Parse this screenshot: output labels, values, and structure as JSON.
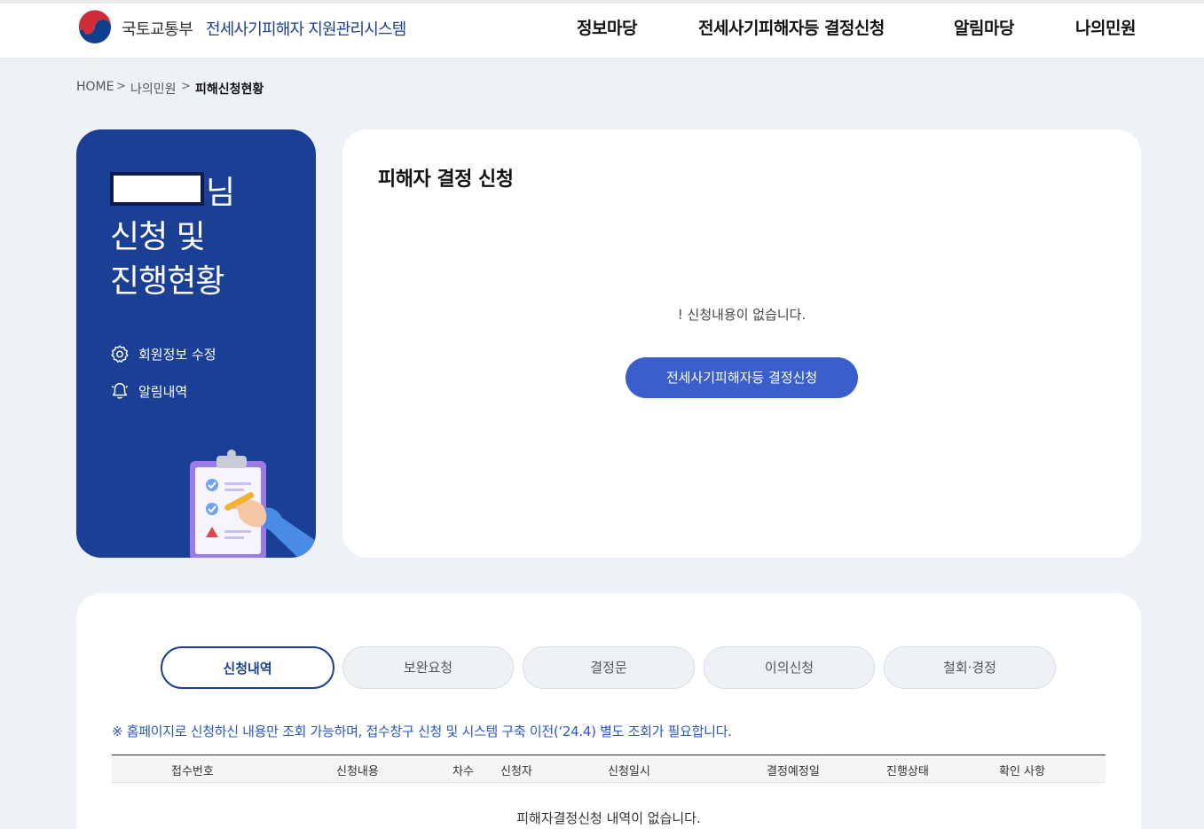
{
  "header": {
    "ministry": "국토교통부",
    "system_name": "전세사기피해자 지원관리시스템",
    "nav": [
      "정보마당",
      "전세사기피해자등 결정신청",
      "알림마당",
      "나의민원"
    ]
  },
  "breadcrumb": {
    "items": [
      "HOME",
      "나의민원",
      "피해신청현황"
    ],
    "separator": ">"
  },
  "sidebar": {
    "name_suffix": "님",
    "title_line1": "신청 및",
    "title_line2": "진행현황",
    "links": [
      "회원정보 수정",
      "알림내역"
    ]
  },
  "main": {
    "title": "피해자 결정 신청",
    "empty_message": "! 신청내용이 없습니다.",
    "apply_button": "전세사기피해자등 결정신청"
  },
  "history": {
    "tabs": [
      "신청내역",
      "보완요청",
      "결정문",
      "이의신청",
      "철회·경정"
    ],
    "active_tab": "신청내역",
    "notice": "※ 홈페이지로 신청하신 내용만 조회 가능하며, 접수창구 신청 및 시스템 구축 이전(‘24.4) 별도 조회가 필요합니다.",
    "columns": [
      "접수번호",
      "신청내용",
      "차수",
      "신청자",
      "신청일시",
      "결정예정일",
      "진행상태",
      "확인 사항"
    ],
    "empty_message": "피해자결정신청 내역이 없습니다."
  },
  "colors": {
    "brand_navy": "#1b3f94",
    "button_blue": "#3a5fcd",
    "notice_blue": "#2a56c6",
    "background": "#eef1f6"
  }
}
